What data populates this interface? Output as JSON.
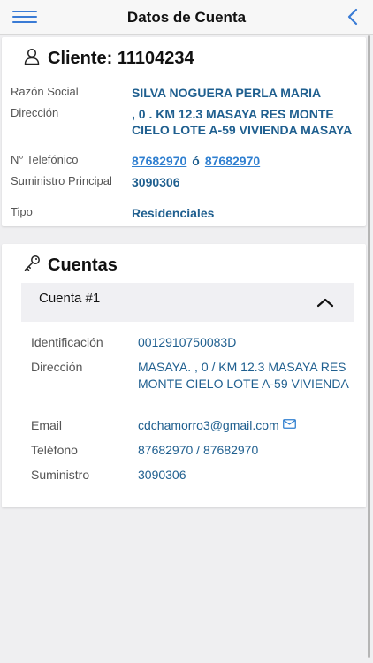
{
  "header": {
    "title": "Datos de Cuenta"
  },
  "cliente": {
    "title": "Cliente: 11104234",
    "fields": [
      {
        "label": "Razón Social",
        "value": "SILVA NOGUERA PERLA MARIA"
      },
      {
        "label": "Dirección",
        "value": ", 0 . KM 12.3 MASAYA RES MONTE CIELO LOTE A-59 VIVIENDA MASAYA"
      },
      {
        "label": "N° Telefónico",
        "phone1": "87682970",
        "separator": "ó",
        "phone2": "87682970"
      },
      {
        "label": "Suministro Principal",
        "value": "3090306"
      },
      {
        "label": "Tipo",
        "value": "Residenciales"
      }
    ]
  },
  "cuentas": {
    "title": "Cuentas",
    "accordion_title": "Cuenta #1",
    "fields": [
      {
        "label": "Identificación",
        "value": "0012910750083D"
      },
      {
        "label": "Dirección",
        "value": "MASAYA. , 0 / KM 12.3 MASAYA RES MONTE CIELO LOTE A-59 VIVIENDA"
      },
      {
        "label": "Email",
        "value": "cdchamorro3@gmail.com"
      },
      {
        "label": "Teléfono",
        "value": "87682970 / 87682970"
      },
      {
        "label": "Suministro",
        "value": "3090306"
      }
    ]
  },
  "colors": {
    "accent": "#3a7bd5",
    "value_text": "#1f5f8f",
    "link": "#2f7fd0"
  },
  "icons": {
    "menu": "hamburger-icon",
    "back": "chevron-left-icon",
    "cliente": "person-icon",
    "cuentas": "key-icon",
    "accordion": "chevron-up-icon",
    "email": "mail-icon"
  }
}
